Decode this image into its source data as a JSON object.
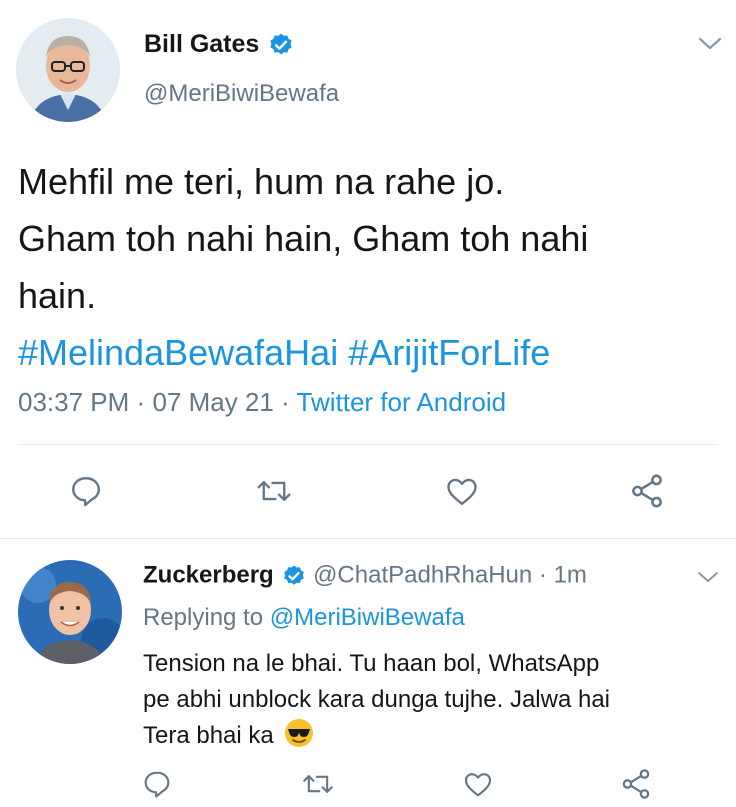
{
  "main_tweet": {
    "author_name": "Bill Gates",
    "handle": "@MeriBiwiBewafa",
    "text_lines": [
      "Mehfil me teri, hum na rahe jo.",
      "Gham toh nahi hain, Gham toh nahi",
      "hain."
    ],
    "hashtags": "#MelindaBewafaHai #ArijitForLife",
    "time": "03:37 PM",
    "date": "07 May 21",
    "sep": "·",
    "source": "Twitter for Android"
  },
  "reply": {
    "author_name": "Zuckerberg",
    "handle": "@ChatPadhRhaHun",
    "sep": "·",
    "age": "1m",
    "replying_prefix": "Replying to",
    "replying_handle": "@MeriBiwiBewafa",
    "text_lines": [
      "Tension na le bhai. Tu haan bol, WhatsApp",
      "pe abhi unblock kara dunga tujhe. Jalwa hai",
      "Tera bhai ka"
    ]
  },
  "colors": {
    "accent": "#1b95e0",
    "muted": "#657786",
    "icon": "#657786",
    "divider": "#e6ecf0"
  },
  "icons": [
    "chevron-down-icon",
    "verified-badge-icon",
    "reply-icon",
    "retweet-icon",
    "like-icon",
    "share-icon",
    "sunglasses-emoji-icon"
  ]
}
